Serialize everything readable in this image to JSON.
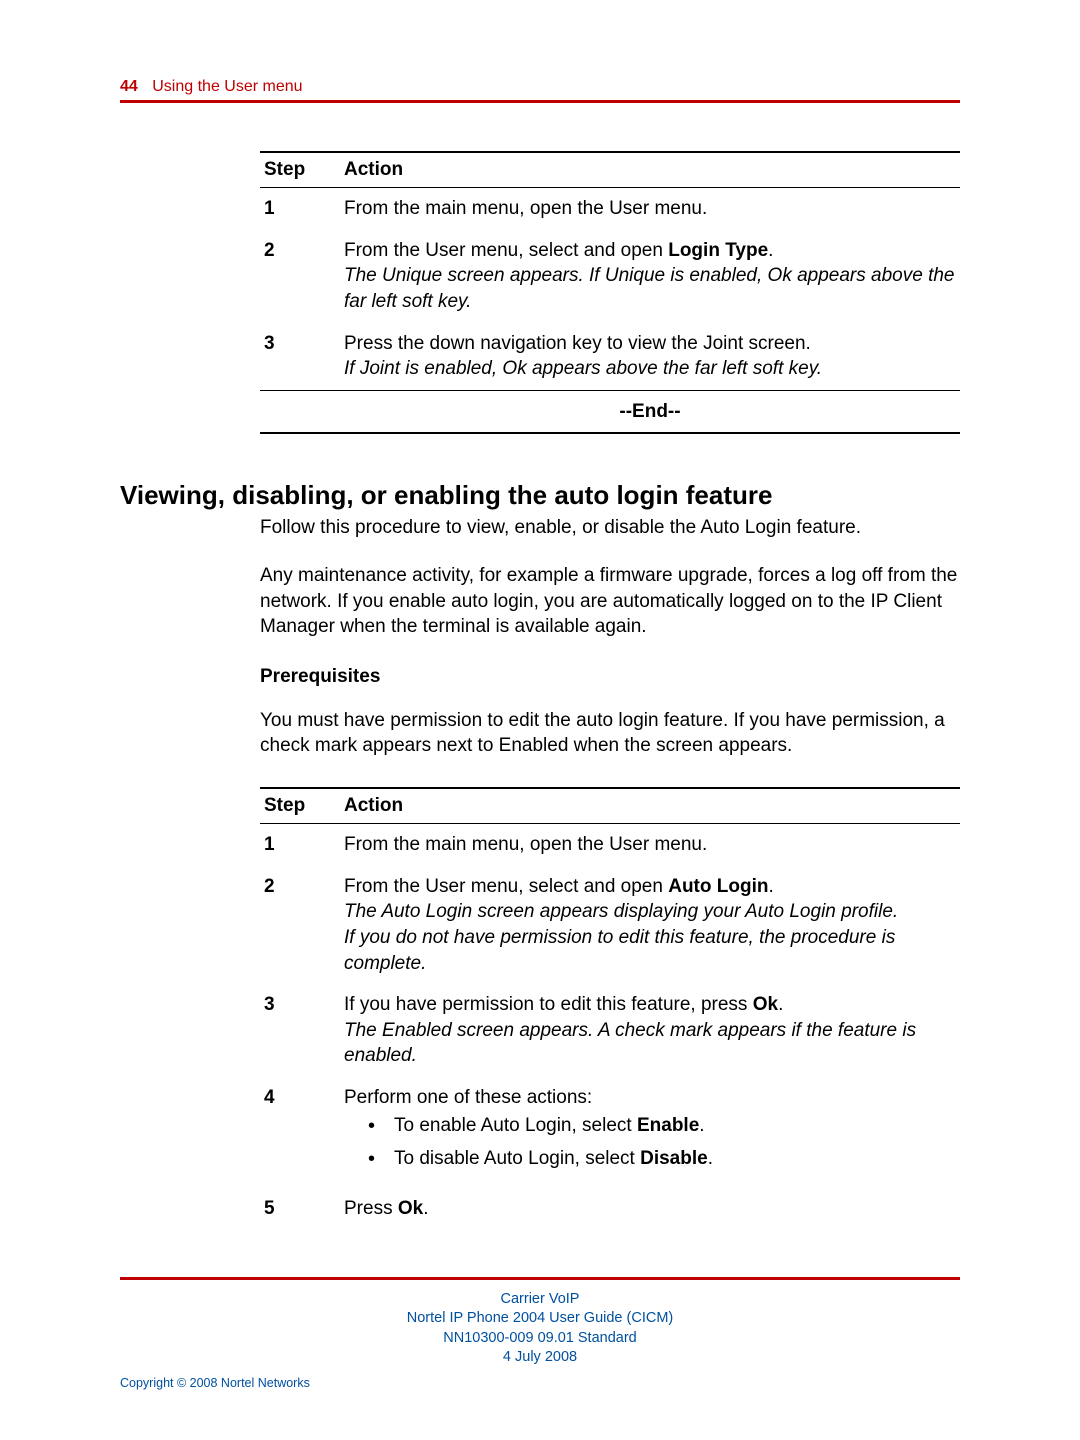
{
  "header": {
    "page_number": "44",
    "title": "Using the User menu"
  },
  "table1": {
    "head_step": "Step",
    "head_action": "Action",
    "rows": [
      {
        "num": "1",
        "text": "From the main menu, open the User menu."
      },
      {
        "num": "2",
        "lead": "From the User menu, select and open ",
        "bold": "Login Type",
        "tail": ".",
        "italic": "The Unique screen appears. If Unique is enabled, Ok appears above the far left soft key."
      },
      {
        "num": "3",
        "text": "Press the down navigation key to view the Joint screen.",
        "italic": "If Joint is enabled, Ok appears above the far left soft key."
      }
    ],
    "end": "--End--"
  },
  "section": {
    "heading": "Viewing, disabling, or enabling the auto login feature",
    "p1": "Follow this procedure to view, enable, or disable the Auto Login feature.",
    "p2": "Any maintenance activity, for example a firmware upgrade, forces a log off from the network. If you enable auto login, you are automatically logged on to the IP Client Manager when the terminal is available again.",
    "prereq_head": "Prerequisites",
    "prereq_body": "You must have permission to edit the auto login feature. If you have permission, a check mark appears next to Enabled when the screen appears."
  },
  "table2": {
    "head_step": "Step",
    "head_action": "Action",
    "r1": {
      "num": "1",
      "text": "From the main menu, open the User menu."
    },
    "r2": {
      "num": "2",
      "lead": "From the User menu, select and open ",
      "bold": "Auto Login",
      "tail": ".",
      "it1": "The Auto Login screen appears displaying your Auto Login profile.",
      "it2": "If you do not have permission to edit this feature, the procedure is complete."
    },
    "r3": {
      "num": "3",
      "lead": "If you have permission to edit this feature, press ",
      "bold": "Ok",
      "tail": ".",
      "it": "The Enabled screen appears. A check mark appears if the feature is enabled."
    },
    "r4": {
      "num": "4",
      "text": "Perform one of these actions:",
      "b1_lead": "To enable Auto Login, select ",
      "b1_bold": "Enable",
      "b1_tail": ".",
      "b2_lead": "To disable Auto Login, select ",
      "b2_bold": "Disable",
      "b2_tail": "."
    },
    "r5": {
      "num": "5",
      "lead": "Press ",
      "bold": "Ok",
      "tail": "."
    }
  },
  "footer": {
    "l1": "Carrier VoIP",
    "l2": "Nortel IP Phone 2004 User Guide (CICM)",
    "l3a": "NN10300-009   09.01   ",
    "l3b": "Standard",
    "l4": "4 July 2008",
    "copyright": "Copyright © 2008 Nortel Networks"
  }
}
